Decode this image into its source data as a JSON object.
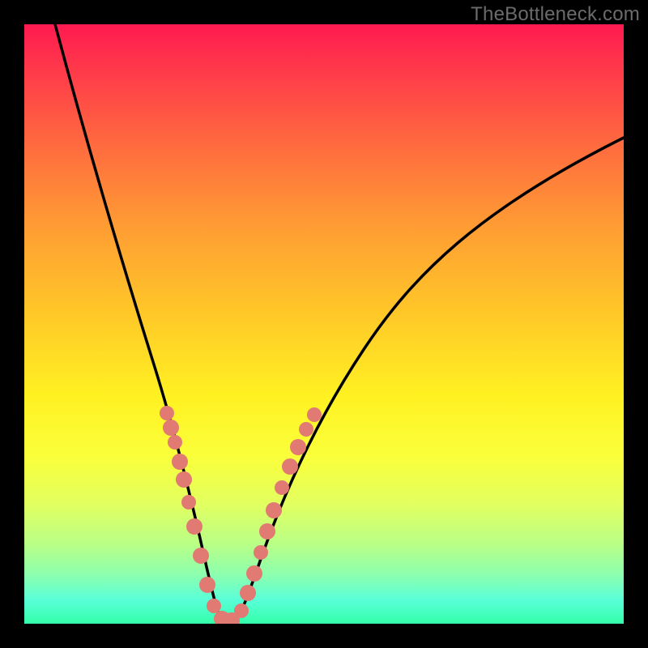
{
  "watermark": "TheBottleneck.com",
  "colors": {
    "frame": "#000000",
    "gradient_top": "#ff1a50",
    "gradient_mid": "#fff122",
    "gradient_bottom": "#33ffaa",
    "curve": "#000000",
    "markers": "#e07a72"
  },
  "chart_data": {
    "type": "line",
    "title": "",
    "xlabel": "",
    "ylabel": "",
    "xlim": [
      0,
      100
    ],
    "ylim": [
      0,
      100
    ],
    "grid": false,
    "legend": false,
    "series": [
      {
        "name": "curve",
        "x": [
          5,
          8,
          12,
          16,
          20,
          24,
          27,
          29,
          30,
          31,
          32,
          33,
          34,
          36,
          38,
          40,
          44,
          50,
          58,
          66,
          74,
          82,
          90,
          98
        ],
        "y": [
          100,
          87,
          72,
          58,
          44,
          30,
          18,
          9,
          4,
          1,
          0,
          0,
          1,
          4,
          10,
          18,
          30,
          42,
          54,
          63,
          70,
          75,
          79,
          82
        ]
      },
      {
        "name": "left-marker-cluster",
        "type": "scatter",
        "x": [
          23,
          24,
          25,
          26,
          27,
          28,
          29,
          30,
          31,
          32
        ],
        "y": [
          31,
          28,
          24,
          20,
          16,
          12,
          8,
          4,
          2,
          0
        ]
      },
      {
        "name": "right-marker-cluster",
        "type": "scatter",
        "x": [
          34,
          35,
          36,
          37,
          38,
          39,
          40,
          42,
          44,
          46
        ],
        "y": [
          2,
          5,
          9,
          13,
          17,
          21,
          25,
          29,
          32,
          34
        ]
      }
    ],
    "annotations": []
  }
}
